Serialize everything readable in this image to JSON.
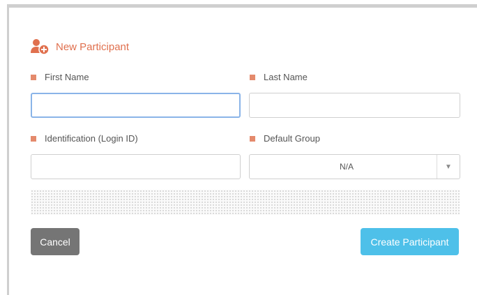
{
  "dialog": {
    "title": "New Participant",
    "title_icon": "user-add-icon",
    "accent_color": "#e0704e"
  },
  "fields": {
    "first_name": {
      "label": "First Name",
      "value": ""
    },
    "last_name": {
      "label": "Last Name",
      "value": ""
    },
    "identification": {
      "label": "Identification (Login ID)",
      "value": ""
    },
    "default_group": {
      "label": "Default Group",
      "selected": "N/A"
    }
  },
  "buttons": {
    "cancel_label": "Cancel",
    "create_label": "Create Participant",
    "create_color": "#4ec0e9",
    "cancel_color": "#757575"
  }
}
